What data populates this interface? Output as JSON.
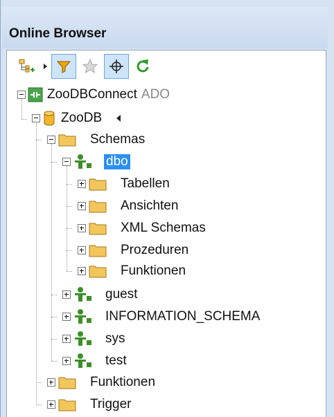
{
  "window": {
    "title": "Online Browser"
  },
  "toolbar": {
    "buttons": [
      {
        "name": "add-objects-icon",
        "pressed": false
      },
      {
        "name": "filter-icon",
        "pressed": true
      },
      {
        "name": "favorites-star-icon",
        "pressed": false
      },
      {
        "name": "locate-crosshair-icon",
        "pressed": true
      },
      {
        "name": "refresh-icon",
        "pressed": false
      }
    ]
  },
  "tree": {
    "connection": {
      "label": "ZooDBConnect",
      "kind": "ADO"
    },
    "database": {
      "label": "ZooDB"
    },
    "schemas_folder": {
      "label": "Schemas"
    },
    "schema_dbo": {
      "label": "dbo",
      "folders": [
        "Tabellen",
        "Ansichten",
        "XML Schemas",
        "Prozeduren",
        "Funktionen"
      ]
    },
    "other_schemas": [
      "guest",
      "INFORMATION_SCHEMA",
      "sys",
      "test"
    ],
    "db_folders": [
      "Funktionen",
      "Trigger"
    ]
  },
  "colors": {
    "selection": "#2b8ff5",
    "folder": "#f3c65c",
    "user": "#3d8f2a"
  }
}
